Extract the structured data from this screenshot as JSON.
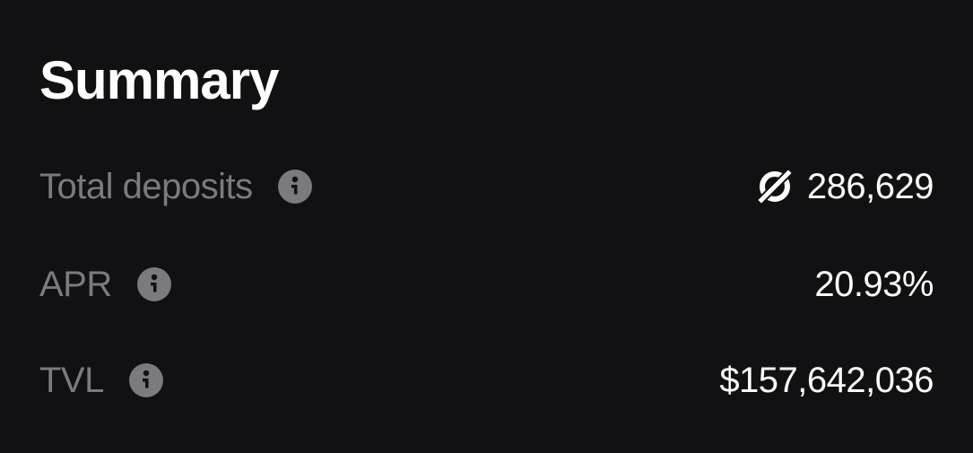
{
  "summary": {
    "title": "Summary",
    "rows": [
      {
        "label": "Total deposits",
        "value": "286,629",
        "token_icon": "token-icon",
        "info_icon": "info-icon"
      },
      {
        "label": "APR",
        "value": "20.93%",
        "info_icon": "info-icon"
      },
      {
        "label": "TVL",
        "value": "$157,642,036",
        "info_icon": "info-icon"
      }
    ]
  },
  "colors": {
    "background": "#111113",
    "label": "#7a7a7f",
    "value": "#ffffff",
    "info_icon_bg": "#7a7a7f"
  }
}
